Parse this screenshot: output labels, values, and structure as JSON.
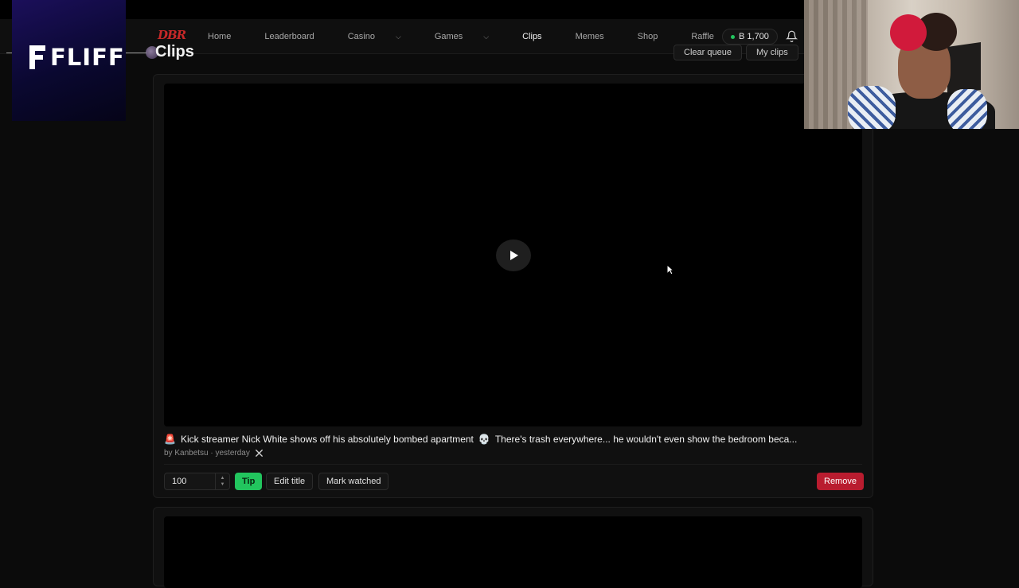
{
  "nav": {
    "logo_text": "DBR",
    "links": [
      {
        "label": "Home",
        "dropdown": false
      },
      {
        "label": "Leaderboard",
        "dropdown": false
      },
      {
        "label": "Casino",
        "dropdown": true
      },
      {
        "label": "Games",
        "dropdown": true
      },
      {
        "label": "Clips",
        "dropdown": false,
        "active": true
      },
      {
        "label": "Memes",
        "dropdown": false
      },
      {
        "label": "Shop",
        "dropdown": false
      },
      {
        "label": "Raffle",
        "dropdown": false
      }
    ],
    "balance": "B 1,700",
    "bell_icon": "bell-icon"
  },
  "page": {
    "title": "Clips",
    "clear_queue_label": "Clear queue",
    "my_clips_label": "My clips"
  },
  "clip": {
    "emoji_prefix": "🚨",
    "title": "Kick streamer Nick White shows off his absolutely bombed apartment",
    "emoji_mid": "💀",
    "title_rest": "There's trash everywhere... he wouldn't even show the bedroom beca...",
    "author_line": "by Kanbetsu · yesterday",
    "source_icon": "x-logo-icon",
    "play_icon": "play-icon",
    "tip_amount": "100",
    "tip_label": "Tip",
    "edit_title_label": "Edit title",
    "mark_watched_label": "Mark watched",
    "remove_label": "Remove"
  },
  "overlay": {
    "brand": "FLIFF"
  },
  "colors": {
    "accent_green": "#22c55e",
    "danger_red": "#b91c2f",
    "logo_red": "#c62828",
    "background": "#0b0b0b"
  }
}
